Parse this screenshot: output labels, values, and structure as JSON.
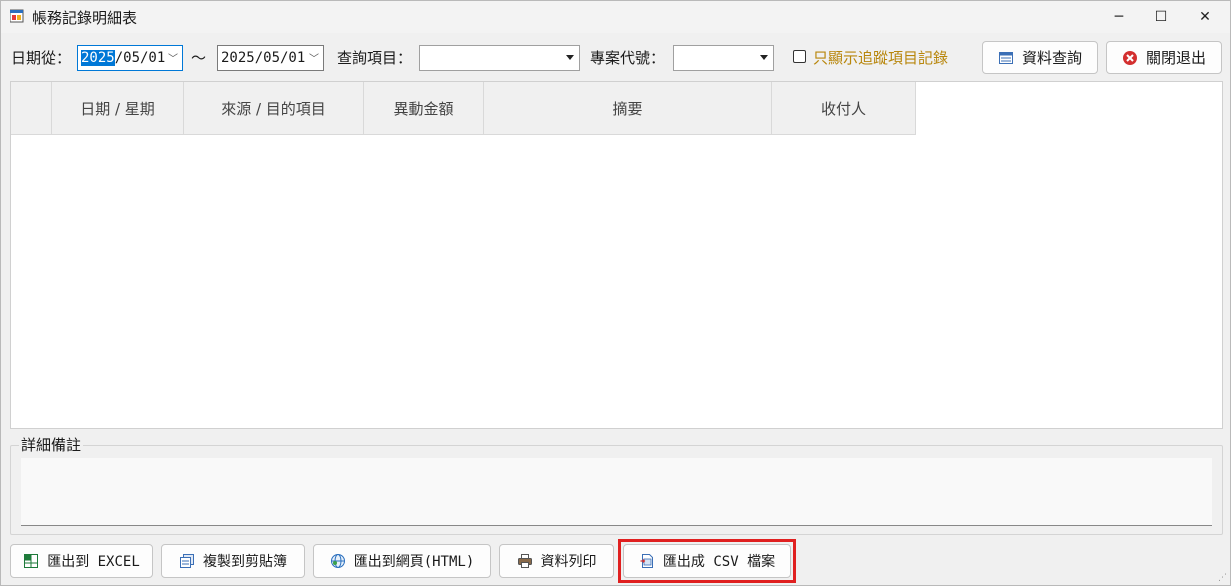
{
  "window": {
    "title": "帳務記錄明細表",
    "minimize_glyph": "─",
    "maximize_glyph": "☐",
    "close_glyph": "✕"
  },
  "filters": {
    "date_from_label": "日期從：",
    "date_from_selected": "2025",
    "date_from_rest": "/05/01",
    "range_separator": "～",
    "date_to_value": "2025/05/01",
    "query_item_label": "查詢項目：",
    "query_item_value": "",
    "project_code_label": "專案代號：",
    "project_code_value": "",
    "tracked_only_label": "只顯示追蹤項目記錄",
    "tracked_only_checked": false
  },
  "actions": {
    "query_label": "資料查詢",
    "close_label": "關閉退出"
  },
  "grid": {
    "columns": [
      "",
      "日期 / 星期",
      "來源 / 目的項目",
      "異動金額",
      "摘要",
      "收付人"
    ],
    "rows": []
  },
  "notes": {
    "title": "詳細備註",
    "value": ""
  },
  "bottom_buttons": {
    "export_excel": "匯出到 EXCEL",
    "copy_clipboard": "複製到剪貼簿",
    "export_html": "匯出到網頁(HTML)",
    "print": "資料列印",
    "export_csv": "匯出成 CSV 檔案"
  },
  "colors": {
    "accent": "#0078d7",
    "highlight_border": "#e02020",
    "checkbox_label": "#b8860b",
    "close_icon": "#d32f2f"
  },
  "icons": {
    "app": "app-window-icon",
    "query": "table-icon",
    "close": "close-circle-icon",
    "excel": "excel-icon",
    "clipboard": "clipboard-icon",
    "html": "globe-icon",
    "print": "printer-icon",
    "csv": "csv-file-icon"
  }
}
